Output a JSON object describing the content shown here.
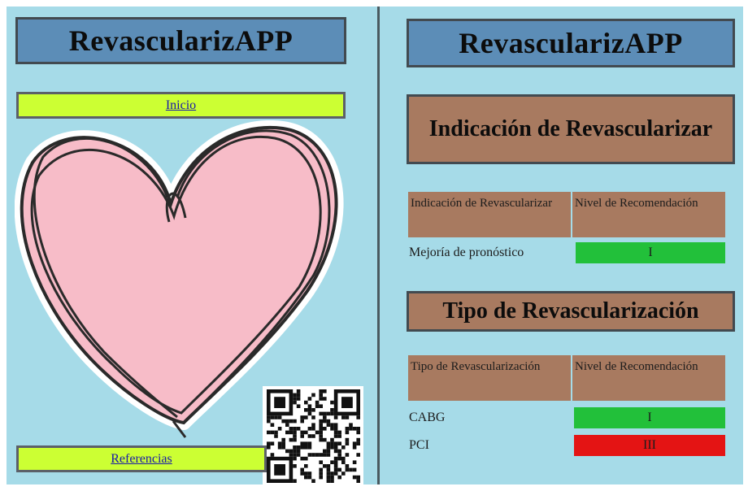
{
  "app_title": "RevascularizAPP",
  "nav": {
    "inicio": "Inicio",
    "referencias": "Referencias"
  },
  "sections": {
    "indicacion_title": "Indicación de Revascularizar",
    "tipo_title": "Tipo de Revascularización"
  },
  "indicacion_table": {
    "headers": [
      "Indicación de Revascularizar",
      "Nivel de Recomendación"
    ],
    "rows": [
      {
        "label": "Mejoría de pronóstico",
        "level": "I",
        "status": "green"
      }
    ]
  },
  "tipo_table": {
    "headers": [
      "Tipo de Revascularización",
      "Nivel de Recomendación"
    ],
    "rows": [
      {
        "label": "CABG",
        "level": "I",
        "status": "green"
      },
      {
        "label": "PCI",
        "level": "III",
        "status": "red"
      }
    ]
  },
  "colors": {
    "background": "#a6dbe8",
    "title_box": "#5c8db7",
    "nav_button": "#ccff33",
    "section_box": "#a87a60",
    "level_green": "#22c03a",
    "level_red": "#e41414",
    "heart_fill": "#f7bcc8"
  },
  "icons": [
    "heart-illustration",
    "qr-code"
  ]
}
